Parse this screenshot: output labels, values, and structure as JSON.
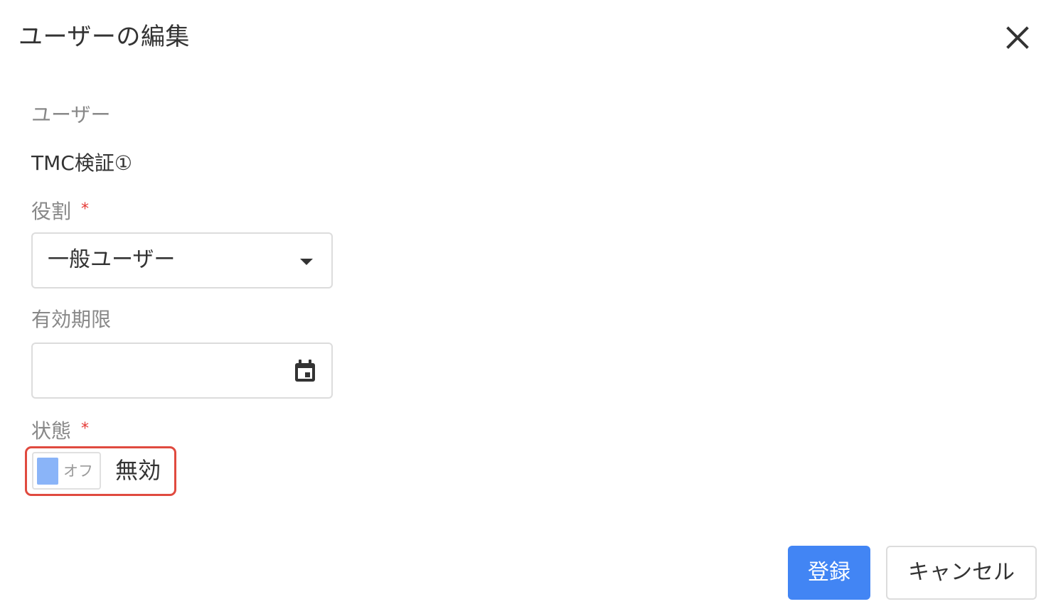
{
  "dialog": {
    "title": "ユーザーの編集",
    "close_icon": "close-icon"
  },
  "form": {
    "user": {
      "label": "ユーザー",
      "value": "TMC検証①"
    },
    "role": {
      "label": "役割",
      "required_mark": "*",
      "value": "一般ユーザー",
      "icon": "chevron-down-icon"
    },
    "expiry": {
      "label": "有効期限",
      "value": "",
      "icon": "calendar-icon"
    },
    "status": {
      "label": "状態",
      "required_mark": "*",
      "toggle_text": "オフ",
      "toggle_on": false,
      "value_text": "無効"
    }
  },
  "actions": {
    "submit_label": "登録",
    "cancel_label": "キャンセル"
  },
  "colors": {
    "primary": "#4285f4",
    "toggle_thumb": "#8ab4f8",
    "required": "#e53935",
    "highlight": "#e04a3f"
  }
}
